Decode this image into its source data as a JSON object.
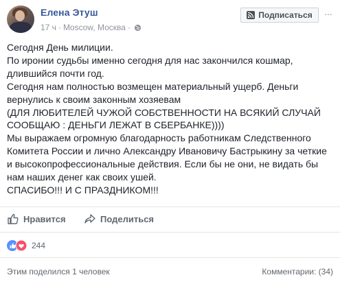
{
  "post": {
    "author": "Елена Этуш",
    "time": "17 ч",
    "separator": "·",
    "location": "Moscow, Москва",
    "subscribe_label": "Подписаться",
    "more": "···",
    "text": "Сегодня День милиции.\nПо иронии судьбы именно сегодня для нас закончился кошмар,\nдлившийся почти год.\nСегодня нам полностью возмещен материальный ущерб. Деньги\nвернулись к своим законным хозяевам\n(ДЛЯ ЛЮБИТЕЛЕЙ ЧУЖОЙ СОБСТВЕННОСТИ НА ВСЯКИЙ СЛУЧАЙ\nСООБЩАЮ : ДЕНЬГИ ЛЕЖАТ В СБЕРБАНКЕ))))\nМы выражаем огромную благодарность работникам Следственного\nКомитета России и лично Александру Ивановичу Бастрыкину за четкие\nи высокопрофессиональные действия. Если бы не они, не видать бы\nнам наших денег как своих ушей.\nСПАСИБО!!! И С ПРАЗДНИКОМ!!!"
  },
  "actions": {
    "like_label": "Нравится",
    "share_label": "Поделиться"
  },
  "reactions": {
    "count": "244",
    "icons": [
      "like-icon",
      "love-icon"
    ]
  },
  "footer": {
    "shared_by": "Этим поделился 1 человек",
    "comments": "Комментарии: (34)"
  },
  "colors": {
    "link": "#365899",
    "like_blue": "#5890ff",
    "love_red": "#f25268",
    "meta_gray": "#90949c"
  }
}
